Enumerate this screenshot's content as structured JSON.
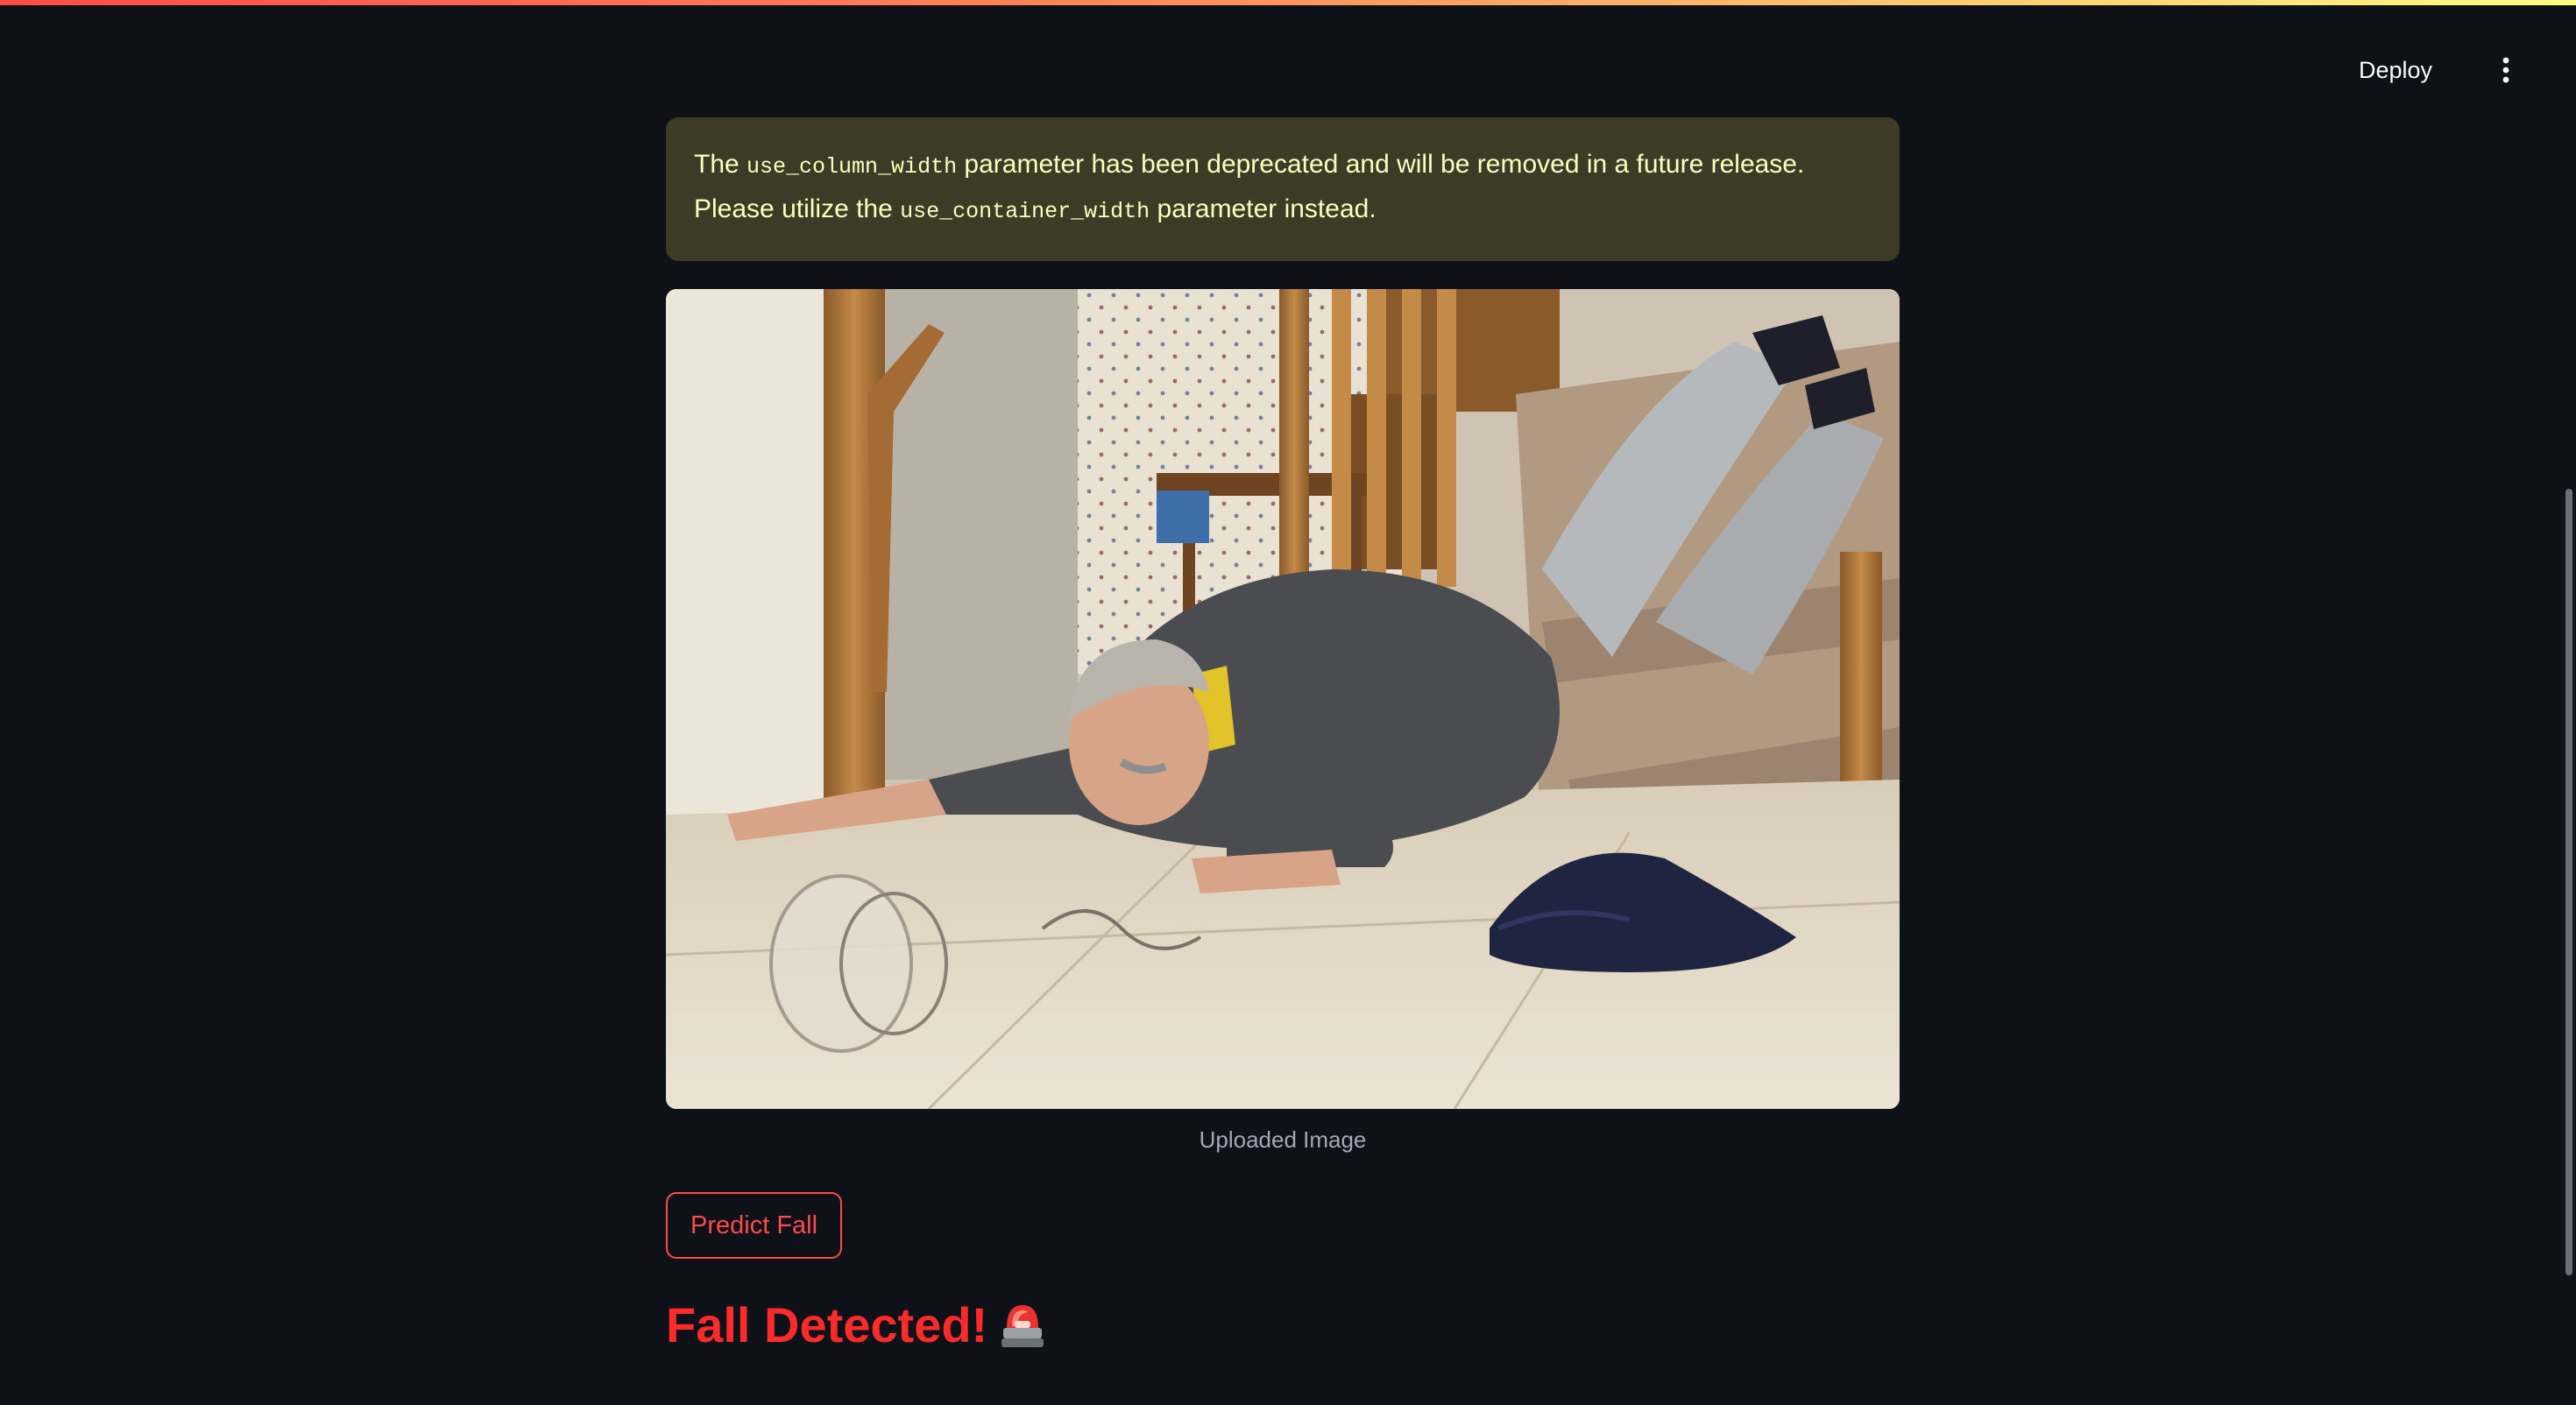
{
  "header": {
    "deploy_label": "Deploy",
    "menu_icon": "vertical-ellipsis-icon"
  },
  "alert": {
    "t1": "The ",
    "code1": "use_column_width",
    "t2": " parameter has been deprecated and will be removed in a future release. Please utilize the ",
    "code2": "use_container_width",
    "t3": " parameter instead.",
    "colors": {
      "background": "#3d3b26",
      "text": "#ffffc2"
    }
  },
  "image": {
    "caption": "Uploaded Image"
  },
  "predict_button": {
    "label": "Predict Fall"
  },
  "result": {
    "title": "Fall Detected!",
    "icon": "rotating-light-icon",
    "color": "#ff2b2b"
  },
  "theme": {
    "background": "#0e1117",
    "accent": "#ff4b4b"
  }
}
